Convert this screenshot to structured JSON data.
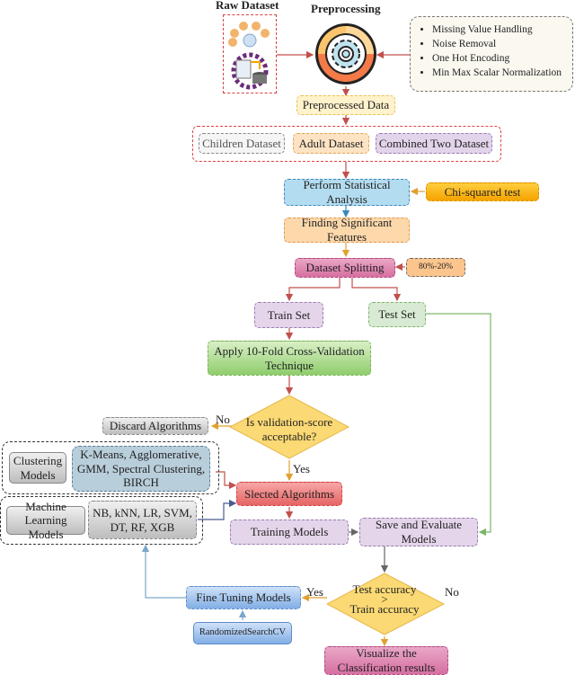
{
  "raw_dataset": {
    "title": "Raw Dataset",
    "icon": "dataset-illustration-icon"
  },
  "preprocessing": {
    "title": "Preprocessing",
    "icon": "gear-icon"
  },
  "preprocessing_steps": [
    "Missing Value Handling",
    "Noise Removal",
    "One Hot Encoding",
    "Min Max Scalar Normalization"
  ],
  "preprocessed_data": "Preprocessed Data",
  "datasets": [
    "Children Dataset",
    "Adult Dataset",
    "Combined Two Dataset"
  ],
  "statistical_analysis": "Perform Statistical Analysis",
  "chi_squared": "Chi-squared test",
  "significant_features": "Finding Significant Features",
  "dataset_splitting": "Dataset Splitting",
  "split_ratio": "80%-20%",
  "train_set": "Train Set",
  "test_set": "Test Set",
  "cross_validation": "Apply 10-Fold Cross-Validation Technique",
  "decision1": {
    "text": "Is validation-score acceptable?",
    "no_label": "No",
    "yes_label": "Yes"
  },
  "discard": "Discard Algorithms",
  "clustering": {
    "label": "Clustering Models",
    "models": "K-Means, Agglomerative, GMM, Spectral Clustering, BIRCH"
  },
  "ml": {
    "label": "Machine Learning Models",
    "models": "NB, kNN, LR, SVM, DT, RF, XGB"
  },
  "selected": "Slected Algorithms",
  "training": "Training Models",
  "save_evaluate": "Save and Evaluate Models",
  "decision2": {
    "line1": "Test accuracy",
    "op": ">",
    "line2": "Train accuracy",
    "yes_label": "Yes",
    "no_label": "No"
  },
  "fine_tuning": "Fine Tuning Models",
  "randomized": "RandomizedSearchCV",
  "visualize": "Visualize the Classification results"
}
